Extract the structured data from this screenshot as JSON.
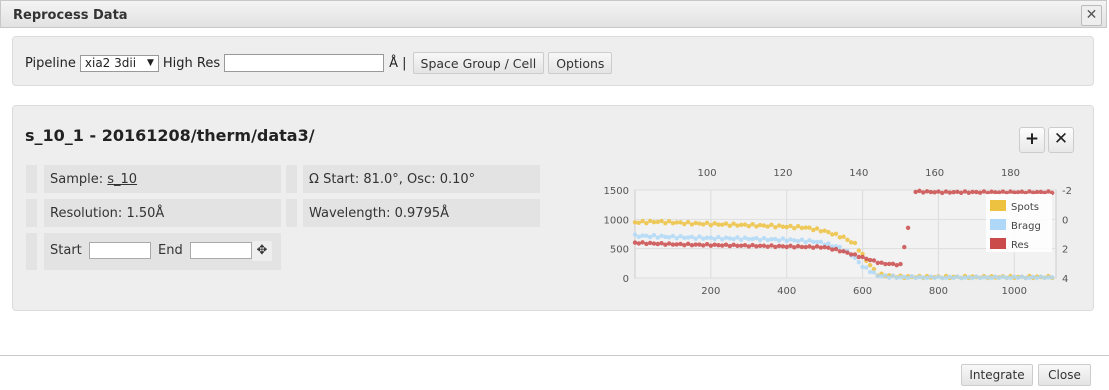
{
  "dialog": {
    "title": "Reprocess Data",
    "close_icon": "close-icon"
  },
  "toolbar": {
    "pipeline_label": "Pipeline",
    "pipeline_value": "xia2 3dii",
    "high_res_label": "High Res",
    "high_res_value": "",
    "angstrom_unit": "Å |",
    "space_group_button": "Space Group / Cell",
    "options_button": "Options"
  },
  "dataset": {
    "title": "s_10_1 - 20161208/therm/data3/",
    "add_icon": "plus-icon",
    "remove_icon": "close-icon",
    "sample_label": "Sample:",
    "sample_link": "s_10",
    "resolution": "Resolution: 1.50Å",
    "start_label": "Start",
    "end_label": "End",
    "start_value": "",
    "end_value": "",
    "move_icon": "move-icon",
    "omega": "Ω Start: 81.0°, Osc: 0.10°",
    "wavelength": "Wavelength: 0.9795Å"
  },
  "footer": {
    "integrate_button": "Integrate",
    "close_button": "Close"
  },
  "chart_data": {
    "type": "scatter",
    "title": "",
    "x_bottom": {
      "ticks": [
        "200",
        "400",
        "600",
        "800",
        "1000"
      ],
      "range": [
        0,
        1110
      ]
    },
    "x_top": {
      "ticks": [
        "100",
        "120",
        "140",
        "160",
        "180"
      ],
      "range": [
        81,
        192
      ]
    },
    "y_left": {
      "ticks": [
        "1500",
        "1000",
        "500",
        "0"
      ],
      "range": [
        0,
        1500
      ]
    },
    "y_right": {
      "ticks": [
        "-2",
        "0",
        "2",
        "4"
      ],
      "range": [
        -2,
        4
      ],
      "inverted": true
    },
    "legend": {
      "position": "right",
      "entries": [
        "Spots",
        "Bragg",
        "Res"
      ]
    },
    "colors": {
      "Spots": "#edc240",
      "Bragg": "#afd8f8",
      "Res": "#cb4b4b"
    },
    "series": [
      {
        "name": "Spots",
        "axis": "left",
        "points": [
          [
            0,
            950
          ],
          [
            60,
            960
          ],
          [
            150,
            930
          ],
          [
            250,
            910
          ],
          [
            350,
            890
          ],
          [
            450,
            860
          ],
          [
            500,
            800
          ],
          [
            550,
            690
          ],
          [
            580,
            580
          ],
          [
            610,
            300
          ],
          [
            640,
            60
          ],
          [
            700,
            20
          ],
          [
            800,
            15
          ],
          [
            900,
            15
          ],
          [
            1000,
            15
          ],
          [
            1100,
            15
          ]
        ]
      },
      {
        "name": "Bragg",
        "axis": "left",
        "points": [
          [
            0,
            720
          ],
          [
            100,
            700
          ],
          [
            200,
            680
          ],
          [
            300,
            670
          ],
          [
            400,
            650
          ],
          [
            480,
            620
          ],
          [
            540,
            520
          ],
          [
            570,
            400
          ],
          [
            600,
            200
          ],
          [
            640,
            40
          ],
          [
            700,
            10
          ],
          [
            800,
            5
          ],
          [
            900,
            5
          ],
          [
            1000,
            5
          ],
          [
            1100,
            5
          ]
        ]
      },
      {
        "name": "Res",
        "axis": "right",
        "points": [
          [
            0,
            1.6
          ],
          [
            100,
            1.7
          ],
          [
            200,
            1.75
          ],
          [
            300,
            1.8
          ],
          [
            400,
            1.85
          ],
          [
            500,
            1.9
          ],
          [
            550,
            2.2
          ],
          [
            600,
            2.6
          ],
          [
            650,
            3.0
          ],
          [
            700,
            3.1
          ],
          [
            740,
            -1.9
          ],
          [
            800,
            -1.85
          ],
          [
            900,
            -1.85
          ],
          [
            1000,
            -1.85
          ],
          [
            1100,
            -1.85
          ]
        ]
      }
    ]
  }
}
